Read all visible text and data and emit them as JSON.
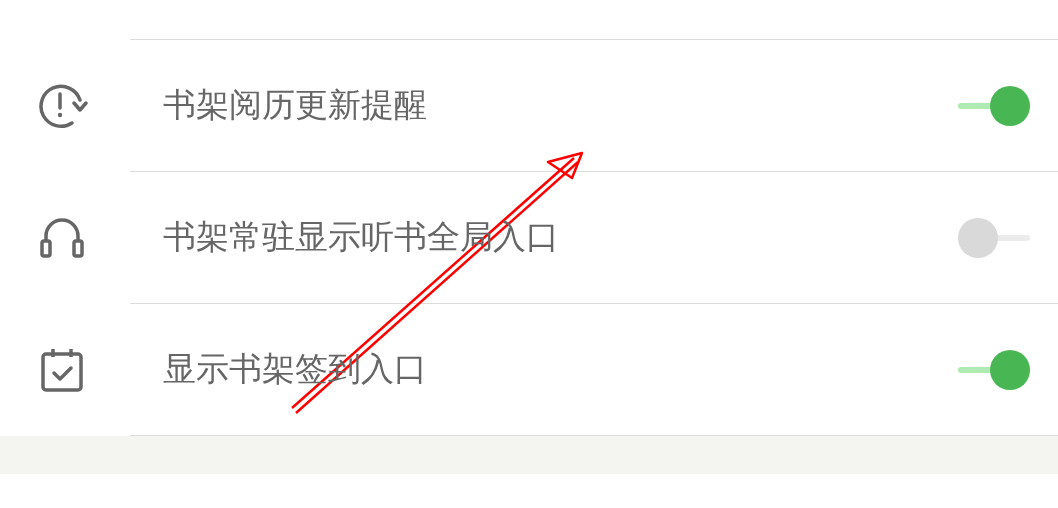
{
  "settings": [
    {
      "label": "书架阅历更新提醒",
      "on": true
    },
    {
      "label": "书架常驻显示听书全局入口",
      "on": false
    },
    {
      "label": "显示书架签到入口",
      "on": true
    }
  ]
}
